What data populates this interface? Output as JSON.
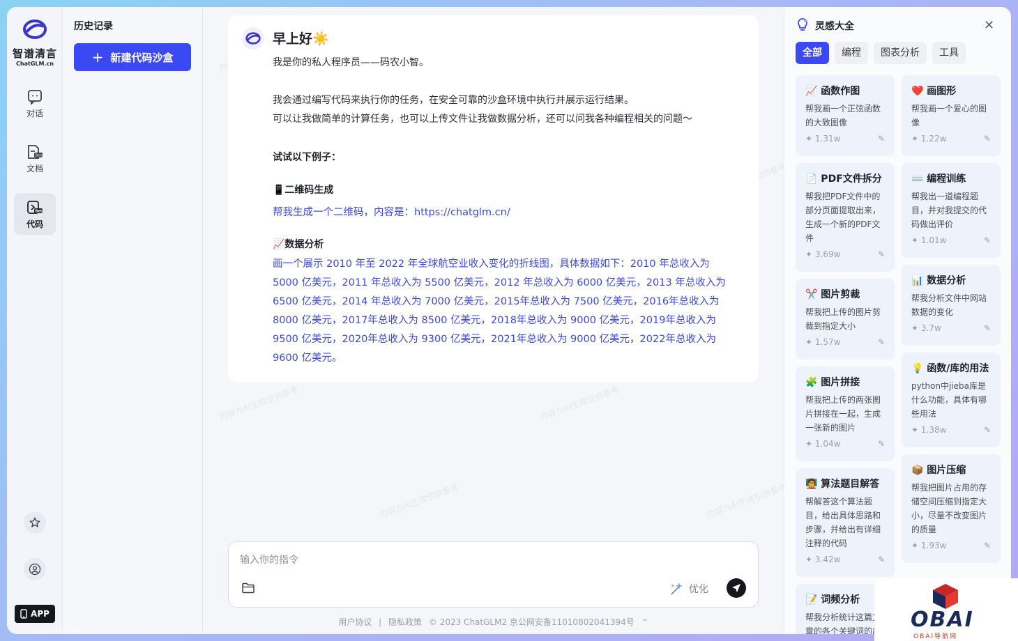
{
  "brand": {
    "name_cn": "智谱清言",
    "name_en": "ChatGLM.cn"
  },
  "rail": {
    "items": [
      {
        "label": "对话"
      },
      {
        "label": "文档"
      },
      {
        "label": "代码"
      }
    ],
    "app_label": "APP"
  },
  "history": {
    "title": "历史记录",
    "new_button": "新建代码沙盒"
  },
  "welcome": {
    "greeting": "早上好☀️",
    "intro": "我是你的私人程序员——码农小智。",
    "desc1": "我会通过编写代码来执行你的任务，在安全可靠的沙盒环境中执行并展示运行结果。",
    "desc2": "可以让我做简单的计算任务，也可以上传文件让我做数据分析，还可以问我各种编程相关的问题～",
    "try_title": "试试以下例子：",
    "examples": [
      {
        "title": "📱二维码生成",
        "prompt": "帮我生成一个二维码，内容是：https://chatglm.cn/"
      },
      {
        "title": "📈数据分析",
        "prompt": "画一个展示 2010 年至 2022 年全球航空业收入变化的折线图，具体数据如下：2010 年总收入为 5000 亿美元，2011 年总收入为 5500 亿美元，2012 年总收入为 6000 亿美元，2013 年总收入为 6500 亿美元，2014 年总收入为 7000 亿美元，2015年总收入为 7500 亿美元，2016年总收入为 8000 亿美元，2017年总收入为 8500 亿美元，2018年总收入为 9000 亿美元，2019年总收入为 9500 亿美元，2020年总收入为 9300 亿美元，2021年总收入为 9000 亿美元，2022年总收入为 9600 亿美元。"
      }
    ]
  },
  "input": {
    "placeholder": "输入你的指令",
    "optimize": "优化"
  },
  "footer": {
    "agreement": "用户协议",
    "sep": "|",
    "privacy": "隐私政策",
    "copyright": "© 2023 ChatGLM2 京公网安备11010802041394号"
  },
  "watermark": "内容为AI生成仅供参考",
  "inspiration": {
    "title": "灵感大全",
    "tabs": [
      "全部",
      "编程",
      "图表分析",
      "工具"
    ],
    "left_cards": [
      {
        "title": "📈 函数作图",
        "desc": "帮我画一个正弦函数的大致图像",
        "count": "1.31w"
      },
      {
        "title": "📄 PDF文件拆分",
        "desc": "帮我把PDF文件中的部分页面提取出来，生成一个新的PDF文件",
        "count": "3.69w"
      },
      {
        "title": "✂️ 图片剪裁",
        "desc": "帮我把上传的图片剪裁到指定大小",
        "count": "1.57w"
      },
      {
        "title": "🧩 图片拼接",
        "desc": "帮我把上传的两张图片拼接在一起，生成一张新的图片",
        "count": "1.04w"
      },
      {
        "title": "🧑‍🏫 算法题目解答",
        "desc": "帮解答这个算法题目，给出具体思路和步骤，并给出有详细注释的代码",
        "count": "3.42w"
      },
      {
        "title": "📝 词频分析",
        "desc": "帮我分析统计这篇文章的各个关键词的出",
        "count": ""
      }
    ],
    "right_cards": [
      {
        "title": "❤️ 画图形",
        "desc": "帮我画一个爱心的图像",
        "count": "1.22w"
      },
      {
        "title": "⌨️ 编程训练",
        "desc": "帮我出一道编程题目，并对我提交的代码做出评价",
        "count": "1.01w"
      },
      {
        "title": "📊 数据分析",
        "desc": "帮我分析文件中网站数据的变化",
        "count": "3.7w"
      },
      {
        "title": "💡 函数/库的用法",
        "desc": "python中jieba库是什么功能，具体有哪些用法",
        "count": "1.38w"
      },
      {
        "title": "📦 图片压缩",
        "desc": "帮我把图片占用的存储空间压缩到指定大小，尽量不改变图片的质量",
        "count": "1.93w"
      }
    ]
  },
  "overlay": {
    "logo_text": "OBAI",
    "logo_sub": "OBAI导航网"
  },
  "colors": {
    "accent": "#3b49f2",
    "link": "#3b46e6"
  }
}
